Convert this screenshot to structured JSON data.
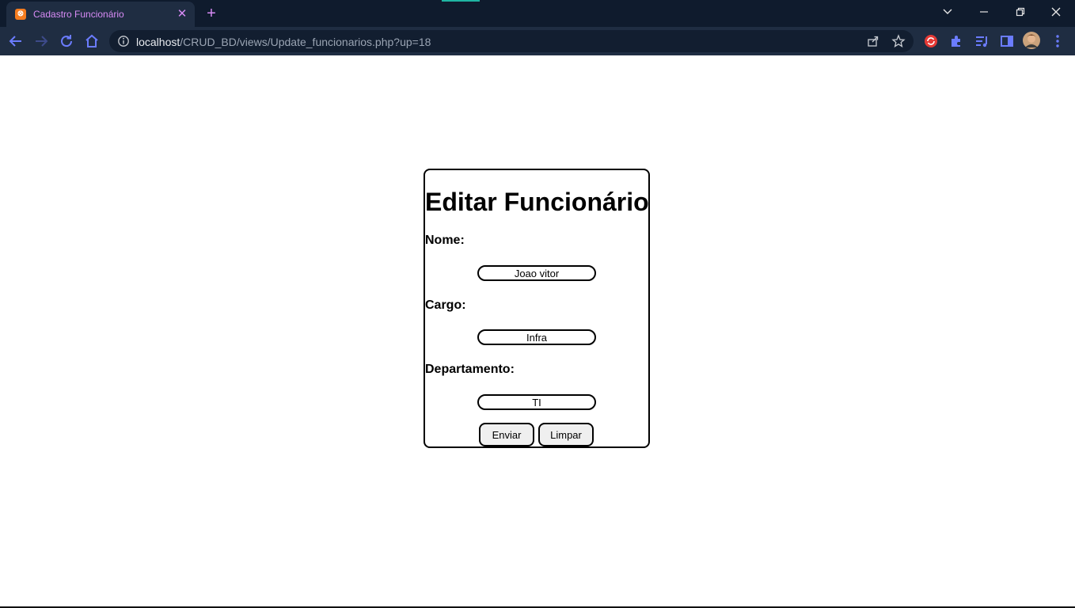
{
  "browser": {
    "tab": {
      "title": "Cadastro Funcionário",
      "favicon": "xampp-icon"
    },
    "url": {
      "host": "localhost",
      "path": "/CRUD_BD/views/Update_funcionarios.php?up=18"
    }
  },
  "form": {
    "title": "Editar Funcionário",
    "fields": [
      {
        "label": "Nome:",
        "value": "Joao vitor"
      },
      {
        "label": "Cargo:",
        "value": "Infra"
      },
      {
        "label": "Departamento:",
        "value": "TI"
      }
    ],
    "buttons": {
      "submit": "Enviar",
      "reset": "Limpar"
    }
  },
  "colors": {
    "chrome_dark": "#0f1b2d",
    "chrome_toolbar": "#1f2d42",
    "accent": "#d78bf5",
    "nav_icon": "#6b7cff"
  }
}
